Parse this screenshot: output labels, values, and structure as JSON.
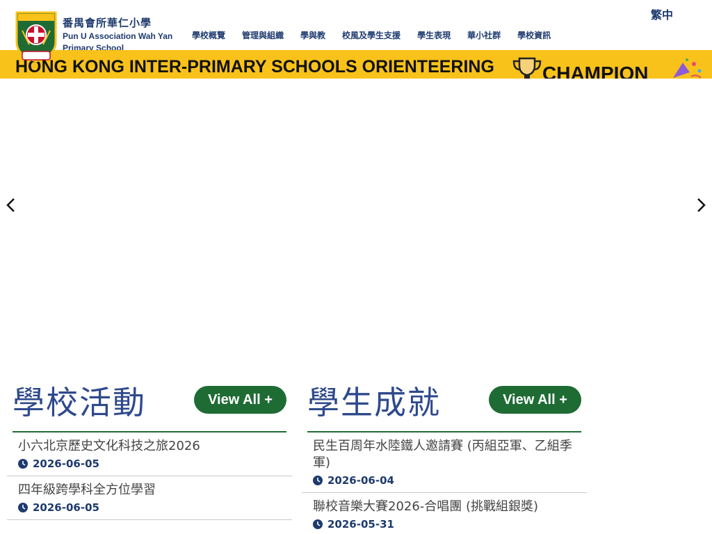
{
  "header": {
    "school_name_zh": "番禺會所華仁小學",
    "school_name_en_line1": "Pun U Association Wah Yan",
    "school_name_en_line2": "Primary School",
    "language_toggle": "繁中",
    "nav": [
      {
        "label": "學校概覽"
      },
      {
        "label": "管理與組織"
      },
      {
        "label": "學與教"
      },
      {
        "label": "校風及學生支援"
      },
      {
        "label": "學生表現"
      },
      {
        "label": "華小社群"
      },
      {
        "label": "學校資訊"
      }
    ],
    "logo_motto": "信勤仁禮"
  },
  "banner": {
    "title": "HONG KONG INTER-PRIMARY SCHOOLS ORIENTEERING",
    "champion": "CHAMPION"
  },
  "activities": {
    "title": "學校活動",
    "view_all": "View All +",
    "items": [
      {
        "title": "小六北京歷史文化科技之旅2026",
        "date": "2026-06-05"
      },
      {
        "title": "四年級跨學科全方位學習",
        "date": "2026-06-05"
      }
    ]
  },
  "achievements": {
    "title": "學生成就",
    "view_all": "View All +",
    "items": [
      {
        "title": "民生百周年水陸鐵人邀請賽 (丙組亞軍、乙組季軍)",
        "date": "2026-06-04"
      },
      {
        "title": "聯校音樂大賽2026-合唱團 (挑戰組銀獎)",
        "date": "2026-05-31"
      }
    ]
  },
  "colors": {
    "brand_blue": "#1e3a6e",
    "brand_green": "#1f6b34",
    "banner_yellow": "#f9c21a"
  }
}
